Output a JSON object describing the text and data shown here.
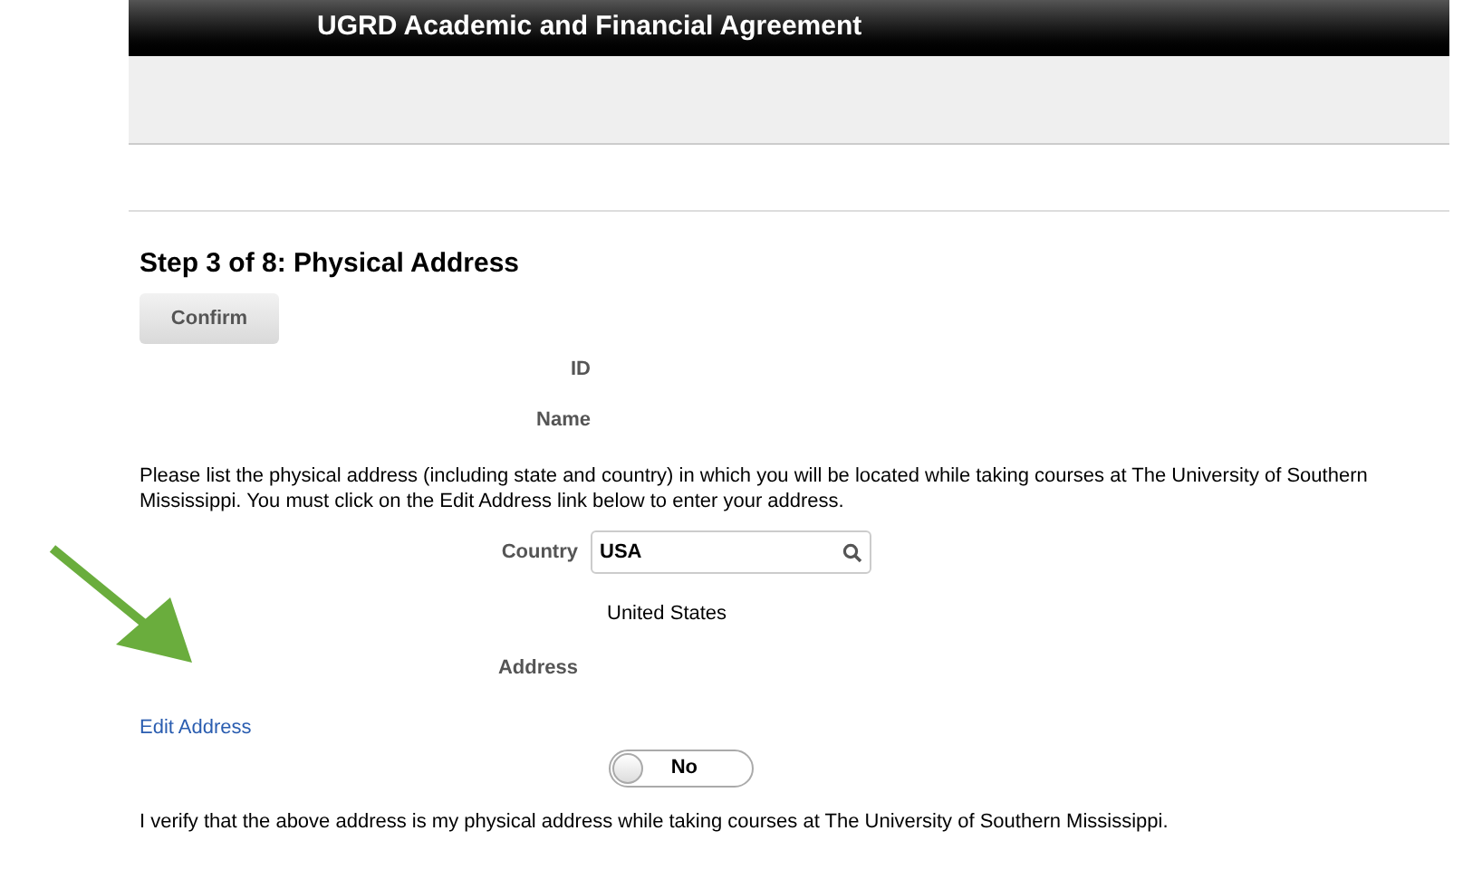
{
  "header": {
    "title": "UGRD Academic and Financial Agreement"
  },
  "step_title": "Step 3 of 8: Physical Address",
  "confirm_button": "Confirm",
  "fields_top": [
    {
      "label": "ID"
    },
    {
      "label": "Name"
    }
  ],
  "instructions": "Please list the physical address (including state and country) in which you will be located while taking courses at The University of Southern Mississippi. You must click on the Edit Address link below to enter your address.",
  "country": {
    "label": "Country",
    "value": "USA",
    "description": "United States"
  },
  "address": {
    "label": "Address"
  },
  "edit_address_link": "Edit Address",
  "toggle": {
    "label": "No",
    "on": false
  },
  "verify_text": "I verify that the above address is my physical address while taking courses at The University of Southern Mississippi."
}
